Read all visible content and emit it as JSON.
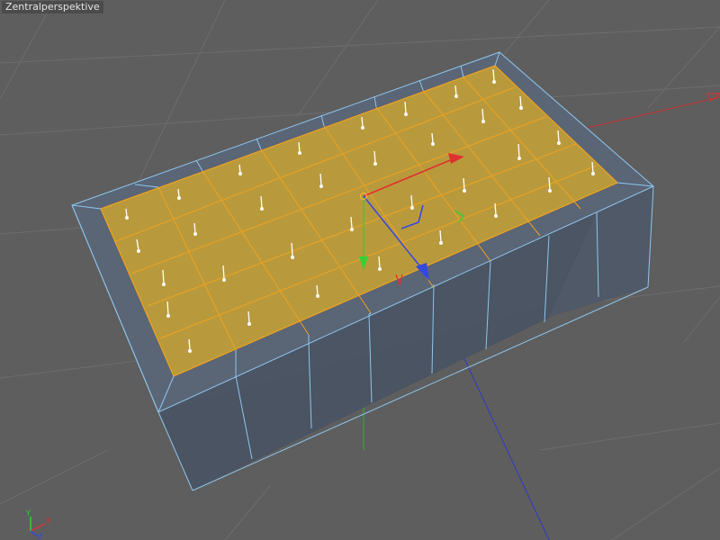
{
  "viewport": {
    "label": "Zentralperspektive",
    "background": "#5e5e5e"
  },
  "colors": {
    "grid": "#6b6b6b",
    "box_side": "#4b5563",
    "box_rim": "#5b6676",
    "selection_fill": "#b99a3c",
    "selection_edge": "#f0a21e",
    "mesh_edge": "#8ec6ee",
    "normal": "#ffffff",
    "axis_x": "#e03030",
    "axis_y": "#35d035",
    "axis_z": "#3548e0"
  },
  "icons": {
    "move_gizmo": "move-gizmo-icon",
    "axis_orientation": "axis-orientation-icon"
  },
  "axis_gizmo": {
    "x_label": "X",
    "y_label": "Y",
    "z_label": "Z"
  }
}
